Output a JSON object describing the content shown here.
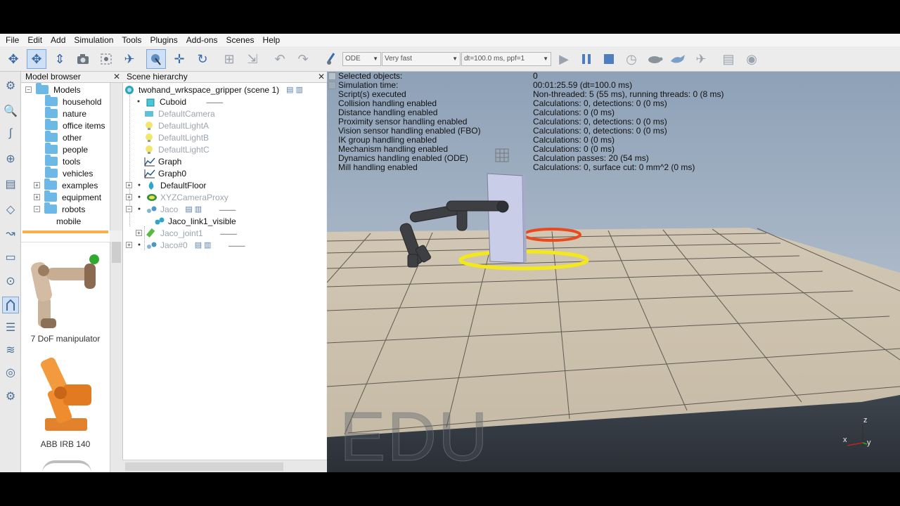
{
  "menu": [
    "File",
    "Edit",
    "Add",
    "Simulation",
    "Tools",
    "Plugins",
    "Add-ons",
    "Scenes",
    "Help"
  ],
  "toolbar": {
    "engine": "ODE",
    "speed": "Very fast",
    "timestep": "dt=100.0 ms, ppf=1"
  },
  "model_browser": {
    "title": "Model browser",
    "close": "✕",
    "tree": [
      {
        "label": "Models",
        "expander": "⊟"
      },
      {
        "label": "household"
      },
      {
        "label": "nature"
      },
      {
        "label": "office items"
      },
      {
        "label": "other"
      },
      {
        "label": "people"
      },
      {
        "label": "tools"
      },
      {
        "label": "vehicles"
      },
      {
        "label": "examples",
        "expander": "⊞"
      },
      {
        "label": "equipment",
        "expander": "⊞"
      },
      {
        "label": "robots",
        "expander": "⊟"
      },
      {
        "label": "mobile"
      }
    ],
    "thumbs": [
      {
        "label": "7 DoF manipulator"
      },
      {
        "label": "ABB IRB 140"
      }
    ]
  },
  "scene_hierarchy": {
    "title": "Scene hierarchy",
    "close": "✕",
    "items": [
      {
        "label": "twohand_wrkspace_gripper (scene 1)",
        "icon": "scene-icon"
      },
      {
        "label": "Cuboid",
        "icon": "cuboid-icon"
      },
      {
        "label": "DefaultCamera",
        "icon": "camera-icon",
        "dim": true
      },
      {
        "label": "DefaultLightA",
        "icon": "light-icon",
        "dim": true
      },
      {
        "label": "DefaultLightB",
        "icon": "light-icon",
        "dim": true
      },
      {
        "label": "DefaultLightC",
        "icon": "light-icon",
        "dim": true
      },
      {
        "label": "Graph",
        "icon": "graph-icon"
      },
      {
        "label": "Graph0",
        "icon": "graph-icon"
      },
      {
        "label": "DefaultFloor",
        "icon": "floor-icon"
      },
      {
        "label": "XYZCameraProxy",
        "icon": "proxy-icon",
        "dim": true
      },
      {
        "label": "Jaco",
        "icon": "robot-icon",
        "dim": true
      },
      {
        "label": "Jaco_link1_visible",
        "icon": "shape-icon"
      },
      {
        "label": "Jaco_joint1",
        "icon": "joint-icon",
        "dim": true
      },
      {
        "label": "Jaco#0",
        "icon": "robot-icon",
        "dim": true
      }
    ]
  },
  "sim_info": [
    {
      "label": "Selected objects:",
      "value": "0"
    },
    {
      "label": "Simulation time:",
      "value": "00:01:25.59 (dt=100.0 ms)"
    },
    {
      "label": "Script(s) executed",
      "value": "Non-threaded: 5 (55 ms), running threads: 0 (8 ms)"
    },
    {
      "label": "Collision handling enabled",
      "value": "Calculations: 0, detections: 0 (0 ms)"
    },
    {
      "label": "Distance handling enabled",
      "value": "Calculations: 0 (0 ms)"
    },
    {
      "label": "Proximity sensor handling enabled",
      "value": "Calculations: 0, detections: 0 (0 ms)"
    },
    {
      "label": "Vision sensor handling enabled (FBO)",
      "value": "Calculations: 0, detections: 0 (0 ms)"
    },
    {
      "label": "IK group handling enabled",
      "value": "Calculations: 0 (0 ms)"
    },
    {
      "label": "Mechanism handling enabled",
      "value": "Calculations: 0 (0 ms)"
    },
    {
      "label": "Dynamics handling enabled (ODE)",
      "value": "Calculation passes: 20 (54 ms)"
    },
    {
      "label": "Mill handling enabled",
      "value": "Calculations: 0, surface cut: 0 mm^2 (0 ms)"
    }
  ],
  "viewport": {
    "watermark": "EDU",
    "axis_z": "z",
    "axis_x": "x",
    "axis_y": "y",
    "sky_top": "#8fa2b8",
    "sky_bottom": "#c6ced8"
  }
}
